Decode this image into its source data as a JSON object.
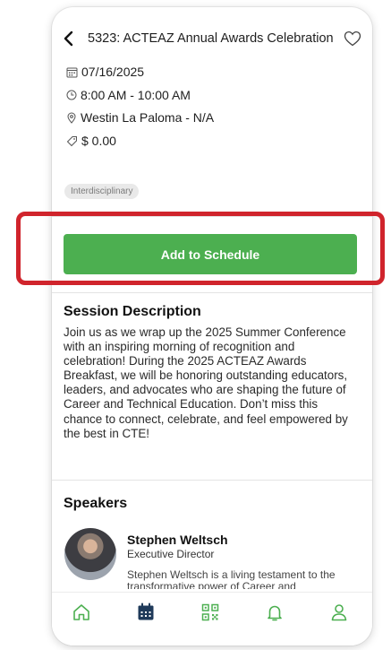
{
  "header": {
    "title": "5323: ACTEAZ Annual Awards Celebration"
  },
  "event": {
    "date": "07/16/2025",
    "time": "8:00 AM - 10:00 AM",
    "location": "Westin La Paloma - N/A",
    "price": "$ 0.00",
    "tag": "Interdisciplinary"
  },
  "actions": {
    "add_label": "Add to Schedule"
  },
  "description": {
    "heading": "Session Description",
    "text": "Join us as we wrap up the 2025 Summer Conference with an inspiring morning of recognition and celebration! During the 2025 ACTEAZ Awards Breakfast, we will be honoring outstanding educators, leaders, and advocates who are shaping the future of Career and Technical Education. Don’t miss this chance to connect, celebrate, and feel empowered by the best in CTE!"
  },
  "speakers": {
    "heading": "Speakers",
    "items": [
      {
        "name": "Stephen Weltsch",
        "role": "Executive Director",
        "bio": "Stephen Weltsch is a living testament to the transformative power of Career and"
      }
    ]
  },
  "tabbar": {
    "items": [
      "home-icon",
      "calendar-icon",
      "qr-code-icon",
      "bell-icon",
      "user-icon"
    ],
    "active": "calendar-icon",
    "accent": "#4caf50"
  },
  "colors": {
    "highlight_box": "#d0242c",
    "button": "#4caf50"
  }
}
